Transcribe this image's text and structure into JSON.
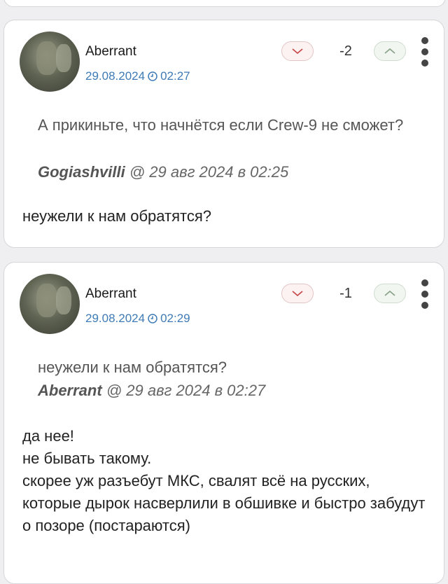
{
  "comments": [
    {
      "user": "Aberrant",
      "date": "29.08.2024",
      "time": "02:27",
      "score": "-2",
      "quote_text": "А прикиньте, что начнётся если Crew-9 не сможет?",
      "quote_author": "Gogiashvilli",
      "quote_meta": "@ 29 авг 2024 в 02:25",
      "body": "неужели к нам обратятся?"
    },
    {
      "user": "Aberrant",
      "date": "29.08.2024",
      "time": "02:29",
      "score": "-1",
      "quote_text": "неужели к нам обратятся?",
      "quote_author": "Aberrant",
      "quote_meta": "@ 29 авг 2024 в 02:27",
      "body": "да нее!\nне бывать такому.\nскорее уж разъебут МКС, свалят всё на русских, которые дырок насверлили в обшивке и быстро забудут о позоре (постараются)"
    }
  ],
  "icons": {
    "clock": "clock-icon",
    "downvote": "chevron-down-icon",
    "upvote": "chevron-up-icon",
    "menu": "more-vertical-icon"
  },
  "colors": {
    "date": "#3f7bb6",
    "downvote_bg": "#fdf2f2",
    "upvote_bg": "#f1f6f1"
  }
}
